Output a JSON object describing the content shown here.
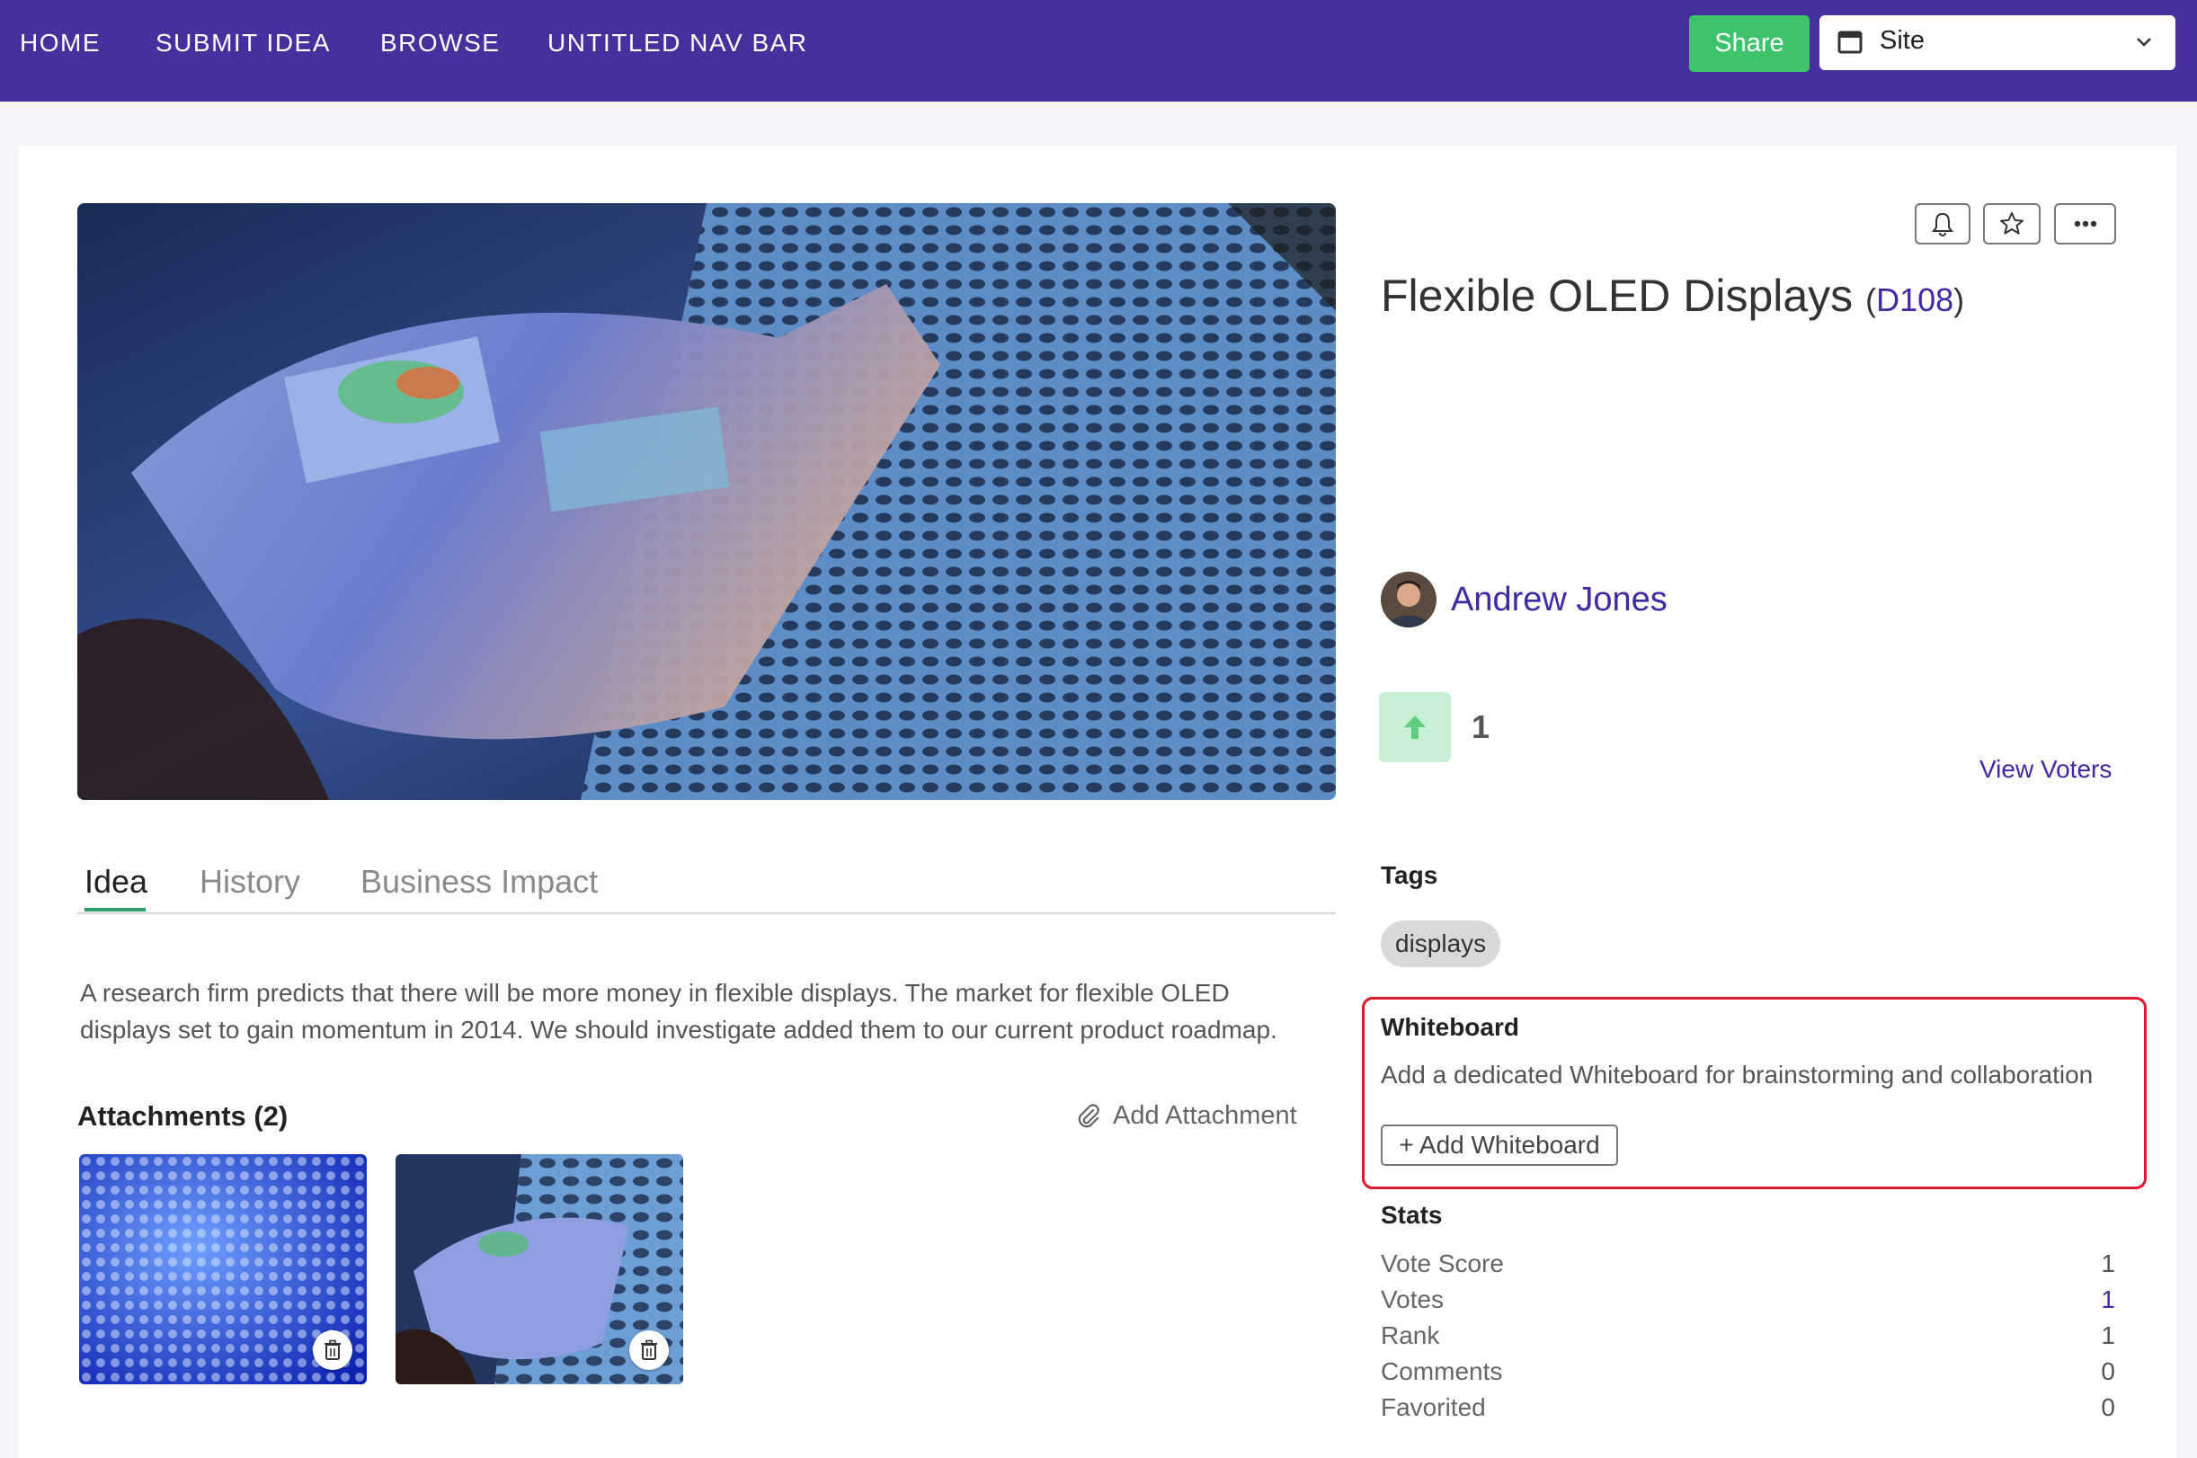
{
  "nav": {
    "items": [
      "HOME",
      "SUBMIT IDEA",
      "BROWSE",
      "UNTITLED NAV BAR"
    ],
    "share_label": "Share",
    "site_select": {
      "value": "Site",
      "icon": "window-icon"
    }
  },
  "colors": {
    "nav_bg": "#47309e",
    "share_bg": "#3dc46b",
    "link": "#3b2ca6",
    "highlight_border": "#e0162b",
    "vote_bg": "#c8f0d4"
  },
  "idea": {
    "title": "Flexible OLED Displays",
    "code_open": "(",
    "code": "D108",
    "code_close": ")",
    "author": "Andrew Jones",
    "vote_count": "1",
    "view_voters": "View Voters",
    "actions": [
      "bell-icon",
      "star-icon",
      "more-icon"
    ]
  },
  "tabs": [
    "Idea",
    "History",
    "Business Impact"
  ],
  "description_line1": "A research firm predicts that there will be more money in flexible displays.  The market for flexible OLED",
  "description_line2": "displays set to gain momentum in 2014.  We should investigate added them to our current product roadmap.",
  "attachments": {
    "title": "Attachments (2)",
    "add_label": "Add Attachment"
  },
  "tags": {
    "heading": "Tags",
    "items": [
      "displays"
    ]
  },
  "whiteboard": {
    "heading": "Whiteboard",
    "description": "Add a dedicated Whiteboard for brainstorming and collaboration",
    "button": "+ Add Whiteboard"
  },
  "stats": {
    "heading": "Stats",
    "rows": [
      {
        "label": "Vote Score",
        "value": "1"
      },
      {
        "label": "Votes",
        "value": "1"
      },
      {
        "label": "Rank",
        "value": "1"
      },
      {
        "label": "Comments",
        "value": "0"
      },
      {
        "label": "Favorited",
        "value": "0"
      }
    ]
  }
}
